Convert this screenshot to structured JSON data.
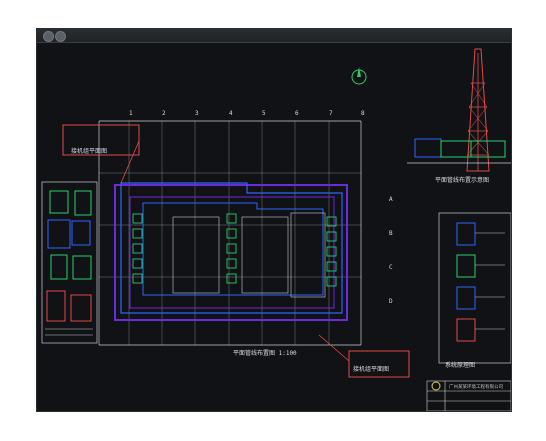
{
  "window": {
    "title": "",
    "bg": "#1b1f24"
  },
  "drawing": {
    "colors": {
      "grid": "#c7c9cc",
      "purple": "#6c2bd9",
      "blue": "#2f64ff",
      "green": "#26d06a",
      "red": "#e14b4b",
      "yellow": "#e1d24a",
      "white": "#e5e7ea"
    },
    "texts": {
      "plan_title": "平面管线布置图 1:100",
      "left_box_title": "接机组平面图",
      "right_box_title": "接机组平面图",
      "elev_title": "平面管线布置示意图",
      "legend_title": "系统原理图",
      "titleblock_company": "广州某某环境工程有限公司"
    },
    "grid_labels": {
      "top": [
        "1",
        "2",
        "3",
        "4",
        "5",
        "6",
        "7",
        "8"
      ],
      "left": [
        "A",
        "B",
        "C",
        "D"
      ]
    }
  }
}
